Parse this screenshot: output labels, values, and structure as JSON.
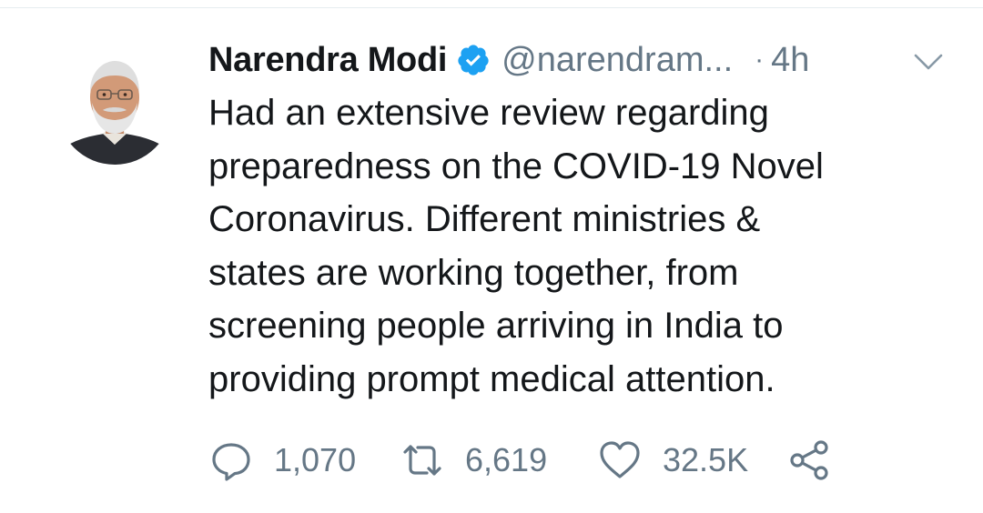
{
  "tweet": {
    "author_name": "Narendra Modi",
    "handle": "@narendram...",
    "separator": "·",
    "time": "4h",
    "text_lines": [
      "Had an extensive review regarding",
      "preparedness on the COVID-19 Novel",
      "Coronavirus. Different ministries &",
      "states are working together, from",
      "screening people arriving in India to",
      "providing prompt medical attention."
    ],
    "replies": "1,070",
    "retweets": "6,619",
    "likes": "32.5K"
  },
  "icons": {
    "verified": "verified-badge-icon",
    "menu": "chevron-down-icon",
    "reply": "reply-icon",
    "retweet": "retweet-icon",
    "like": "heart-icon",
    "share": "share-icon"
  },
  "colors": {
    "text": "#14171a",
    "secondary": "#657786",
    "verified": "#1da1f2",
    "divider": "#e6ecf0"
  }
}
